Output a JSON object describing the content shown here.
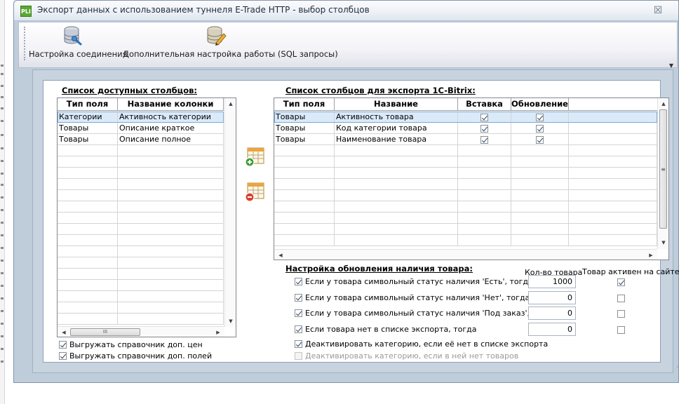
{
  "window": {
    "logo_text": "PLI",
    "title": "Экспорт данных с использованием туннеля E-Trade HTTP - выбор столбцов",
    "close_glyph": "☒"
  },
  "toolbar": {
    "connection_label": "Настройка соединения",
    "connection_icon": "database-wrench-icon",
    "sql_label": "Дополнительная настройка работы (SQL запросы)",
    "sql_icon": "database-pencil-icon",
    "overflow_glyph": "▼"
  },
  "available": {
    "title": "Список доступных столбцов:",
    "headers": [
      "Тип поля",
      "Название колонки"
    ],
    "rows": [
      [
        "Категории",
        "Активность категории"
      ],
      [
        "Товары",
        "Описание краткое"
      ],
      [
        "Товары",
        "Описание полное"
      ]
    ],
    "hscroll_grip": "III"
  },
  "export": {
    "title": "Список столбцов для экспорта 1C-Bitrix:",
    "headers": [
      "Тип поля",
      "Название",
      "Вставка",
      "Обновление"
    ],
    "rows": [
      {
        "type": "Товары",
        "name": "Активность товара",
        "insert": true,
        "update": true
      },
      {
        "type": "Товары",
        "name": "Код категории товара",
        "insert": true,
        "update": true
      },
      {
        "type": "Товары",
        "name": "Наименование товара",
        "insert": true,
        "update": true
      }
    ],
    "vscroll_grip": "≡"
  },
  "actions": {
    "add_icon": "table-add-icon",
    "remove_icon": "table-remove-icon"
  },
  "stock": {
    "title": "Настройка обновления наличия товара:",
    "col_qty": "Кол-во товара",
    "col_active": "Товар активен на сайте",
    "options": [
      {
        "label": "Если у товара символьный статус наличия 'Есть', тогда",
        "checked": true,
        "qty": "1000",
        "active": true
      },
      {
        "label": "Если у товара символьный статус наличия 'Нет', тогда",
        "checked": true,
        "qty": "0",
        "active": false
      },
      {
        "label": "Если у товара символьный статус наличия 'Под заказ', тогда",
        "checked": true,
        "qty": "0",
        "active": false
      },
      {
        "label": "Если товара нет в списке экспорта, тогда",
        "checked": true,
        "qty": "0",
        "active": false
      }
    ],
    "deactivate_missing": "Деактивировать категорию, если её нет в списке экспорта",
    "deactivate_empty": "Деактивировать категорию, если в ней нет товаров"
  },
  "extra": {
    "export_prices": "Выгружать справочник доп. цен",
    "export_fields": "Выгружать справочник доп. полей"
  },
  "colors": {
    "dialog_bg": "#bfcddb",
    "panel_bg": "#c7d3df",
    "selection": "#dbeaf9",
    "accent_green": "#5aa832",
    "remove_red": "#d8402c"
  }
}
